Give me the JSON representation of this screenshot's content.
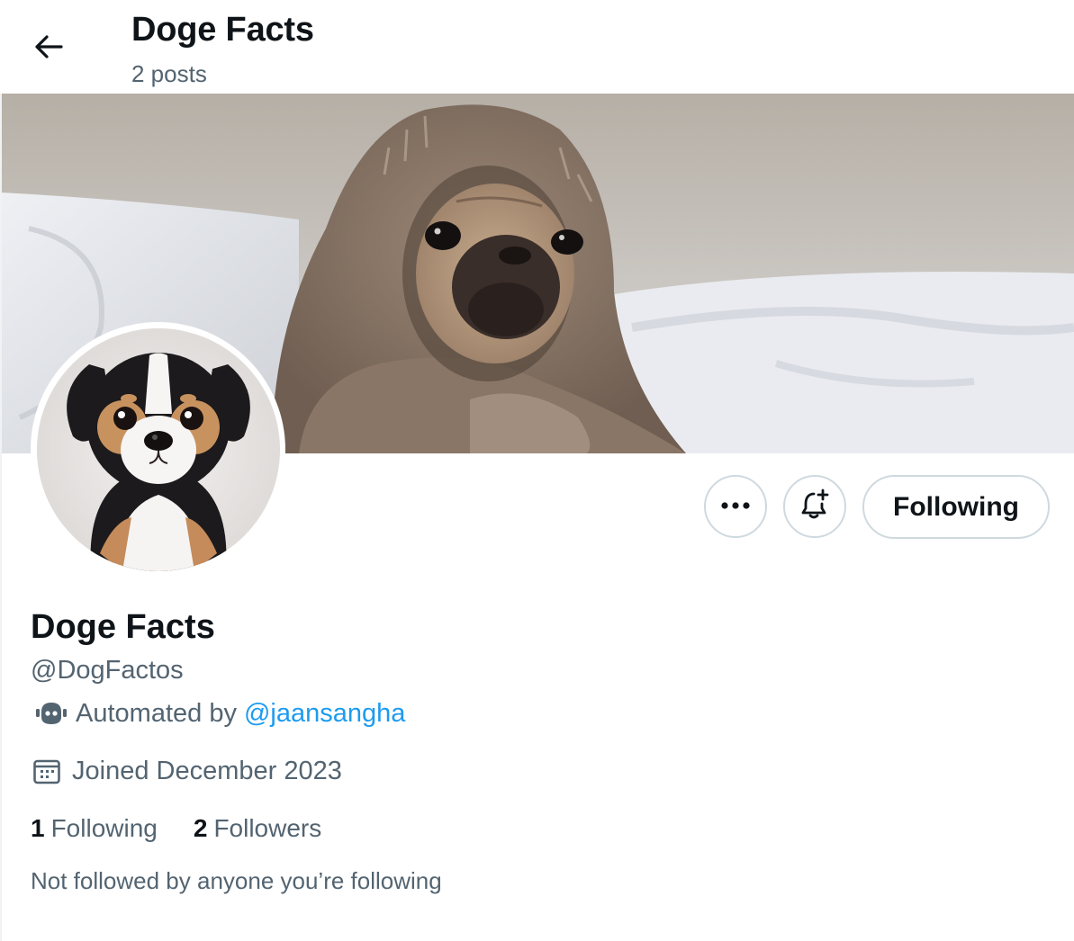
{
  "header": {
    "title": "Doge Facts",
    "post_count": "2 posts"
  },
  "icons": {
    "back": "arrow-left-icon",
    "more": "more-horizontal-icon",
    "notify": "bell-plus-icon",
    "bot": "robot-icon",
    "calendar": "calendar-icon"
  },
  "actions": {
    "following_label": "Following"
  },
  "profile": {
    "display_name": "Doge Facts",
    "handle": "@DogFactos",
    "automated_prefix": "Automated by",
    "automated_by": "@jaansangha",
    "joined": "Joined December 2023",
    "following_count": "1",
    "following_label": "Following",
    "followers_count": "2",
    "followers_label": "Followers",
    "followed_by": "Not followed by anyone you’re following"
  },
  "colors": {
    "text_primary": "#0f1419",
    "text_secondary": "#536471",
    "link": "#1d9bf0",
    "border": "#cfd9de"
  }
}
